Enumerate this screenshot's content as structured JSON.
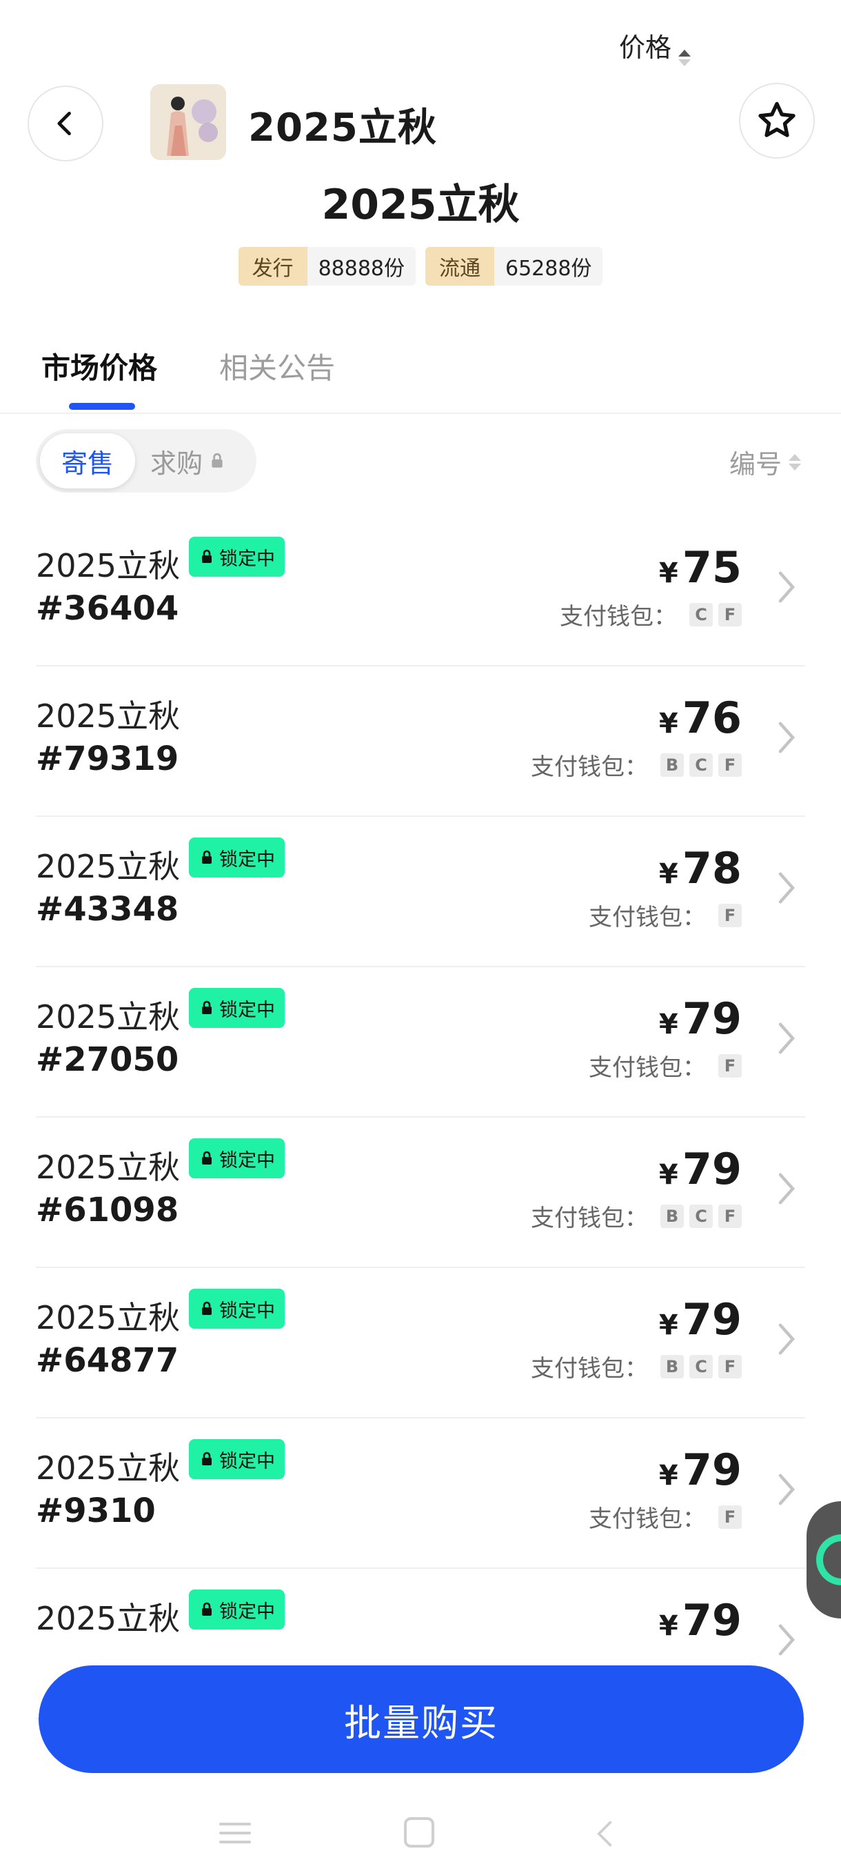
{
  "header": {
    "title": "2025立秋",
    "main_title": "2025立秋",
    "stats": [
      {
        "key": "发行",
        "value": "88888份"
      },
      {
        "key": "流通",
        "value": "65288份"
      }
    ]
  },
  "tabs": [
    {
      "label": "市场价格",
      "active": true
    },
    {
      "label": "相关公告",
      "active": false
    }
  ],
  "filter": {
    "segments": [
      {
        "label": "寄售",
        "active": true
      },
      {
        "label": "求购",
        "active": false,
        "locked": true
      }
    ],
    "sort": [
      {
        "label": "价格",
        "active": true
      },
      {
        "label": "编号",
        "active": false
      }
    ]
  },
  "list": {
    "currency": "¥",
    "wallet_label": "支付钱包：",
    "lock_label": "锁定中",
    "items": [
      {
        "name": "2025立秋",
        "serial": "#36404",
        "locked": true,
        "price": "75",
        "wallets": [
          "C",
          "F"
        ]
      },
      {
        "name": "2025立秋",
        "serial": "#79319",
        "locked": false,
        "price": "76",
        "wallets": [
          "B",
          "C",
          "F"
        ]
      },
      {
        "name": "2025立秋",
        "serial": "#43348",
        "locked": true,
        "price": "78",
        "wallets": [
          "F"
        ]
      },
      {
        "name": "2025立秋",
        "serial": "#27050",
        "locked": true,
        "price": "79",
        "wallets": [
          "F"
        ]
      },
      {
        "name": "2025立秋",
        "serial": "#61098",
        "locked": true,
        "price": "79",
        "wallets": [
          "B",
          "C",
          "F"
        ]
      },
      {
        "name": "2025立秋",
        "serial": "#64877",
        "locked": true,
        "price": "79",
        "wallets": [
          "B",
          "C",
          "F"
        ]
      },
      {
        "name": "2025立秋",
        "serial": "#9310",
        "locked": true,
        "price": "79",
        "wallets": [
          "F"
        ]
      },
      {
        "name": "2025立秋",
        "serial": "",
        "locked": true,
        "price": "79",
        "wallets": []
      }
    ]
  },
  "bulk_buy": {
    "label": "批量购买"
  },
  "colors": {
    "accent": "#1f55f2",
    "lock_badge": "#1ff2a5",
    "stat_key_bg": "#f5dfb6"
  }
}
